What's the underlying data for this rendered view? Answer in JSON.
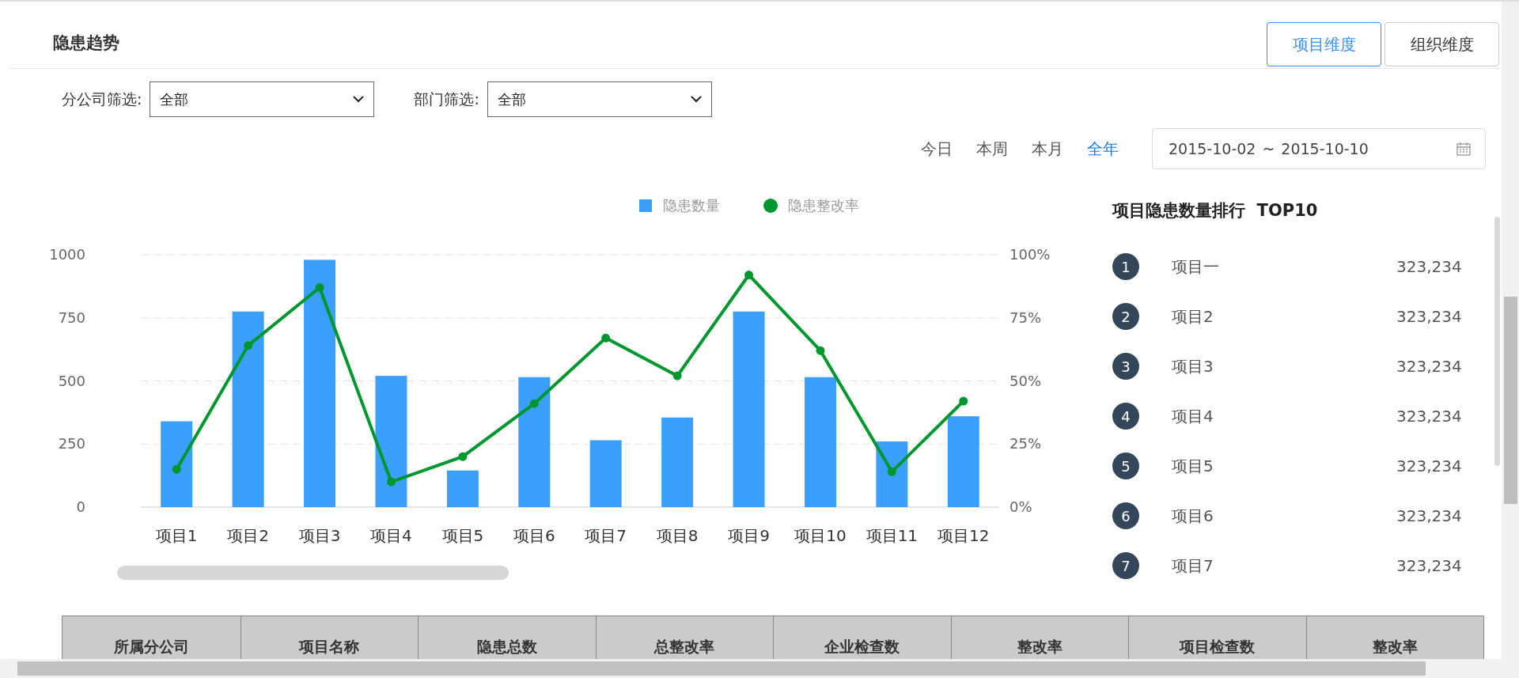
{
  "header": {
    "title": "隐患趋势",
    "tabs": [
      {
        "label": "项目维度",
        "selected": true
      },
      {
        "label": "组织维度",
        "selected": false
      }
    ]
  },
  "filters": [
    {
      "label": "分公司筛选:",
      "value": "全部"
    },
    {
      "label": "部门筛选:",
      "value": "全部"
    }
  ],
  "periods": [
    {
      "label": "今日",
      "selected": false
    },
    {
      "label": "本周",
      "selected": false
    },
    {
      "label": "本月",
      "selected": false
    },
    {
      "label": "全年",
      "selected": true
    }
  ],
  "date_range": {
    "start": "2015-10-02",
    "separator": "~",
    "end": "2015-10-10"
  },
  "chart_data": {
    "type": "bar",
    "categories": [
      "项目1",
      "项目2",
      "项目3",
      "项目4",
      "项目5",
      "项目6",
      "项目7",
      "项目8",
      "项目9",
      "项目10",
      "项目11",
      "项目12"
    ],
    "series": [
      {
        "name": "隐患数量",
        "color": "#3b9ffc",
        "values": [
          340,
          775,
          980,
          520,
          145,
          515,
          265,
          355,
          775,
          515,
          260,
          360
        ]
      },
      {
        "name": "隐患整改率",
        "type": "line",
        "axis": "y2",
        "marker": "circle",
        "color": "#00972f",
        "values": [
          15,
          64,
          87,
          10,
          20,
          41,
          67,
          52,
          92,
          62,
          14,
          42
        ]
      }
    ],
    "ylim": [
      0,
      1000
    ],
    "y2lim": [
      0,
      100
    ],
    "grid": true,
    "legend": true,
    "yticks": [
      0,
      250,
      500,
      750,
      1000
    ],
    "y2ticks": [
      {
        "value": 0,
        "label": "0%"
      },
      {
        "value": 25,
        "label": "25%"
      },
      {
        "value": 50,
        "label": "50%"
      },
      {
        "value": 75,
        "label": "75%"
      },
      {
        "value": 100,
        "label": "100%"
      }
    ]
  },
  "ranking": {
    "title": "项目隐患数量排行  TOP10",
    "items": [
      {
        "rank": "1",
        "name": "项目一",
        "count": "323,234"
      },
      {
        "rank": "2",
        "name": "项目2",
        "count": "323,234"
      },
      {
        "rank": "3",
        "name": "项目3",
        "count": "323,234"
      },
      {
        "rank": "4",
        "name": "项目4",
        "count": "323,234"
      },
      {
        "rank": "5",
        "name": "项目5",
        "count": "323,234"
      },
      {
        "rank": "6",
        "name": "项目6",
        "count": "323,234"
      },
      {
        "rank": "7",
        "name": "项目7",
        "count": "323,234"
      }
    ]
  },
  "table": {
    "columns": [
      "所属分公司",
      "项目名称",
      "隐患总数",
      "总整改率",
      "企业检查数",
      "整改率",
      "项目检查数",
      "整改率"
    ]
  }
}
